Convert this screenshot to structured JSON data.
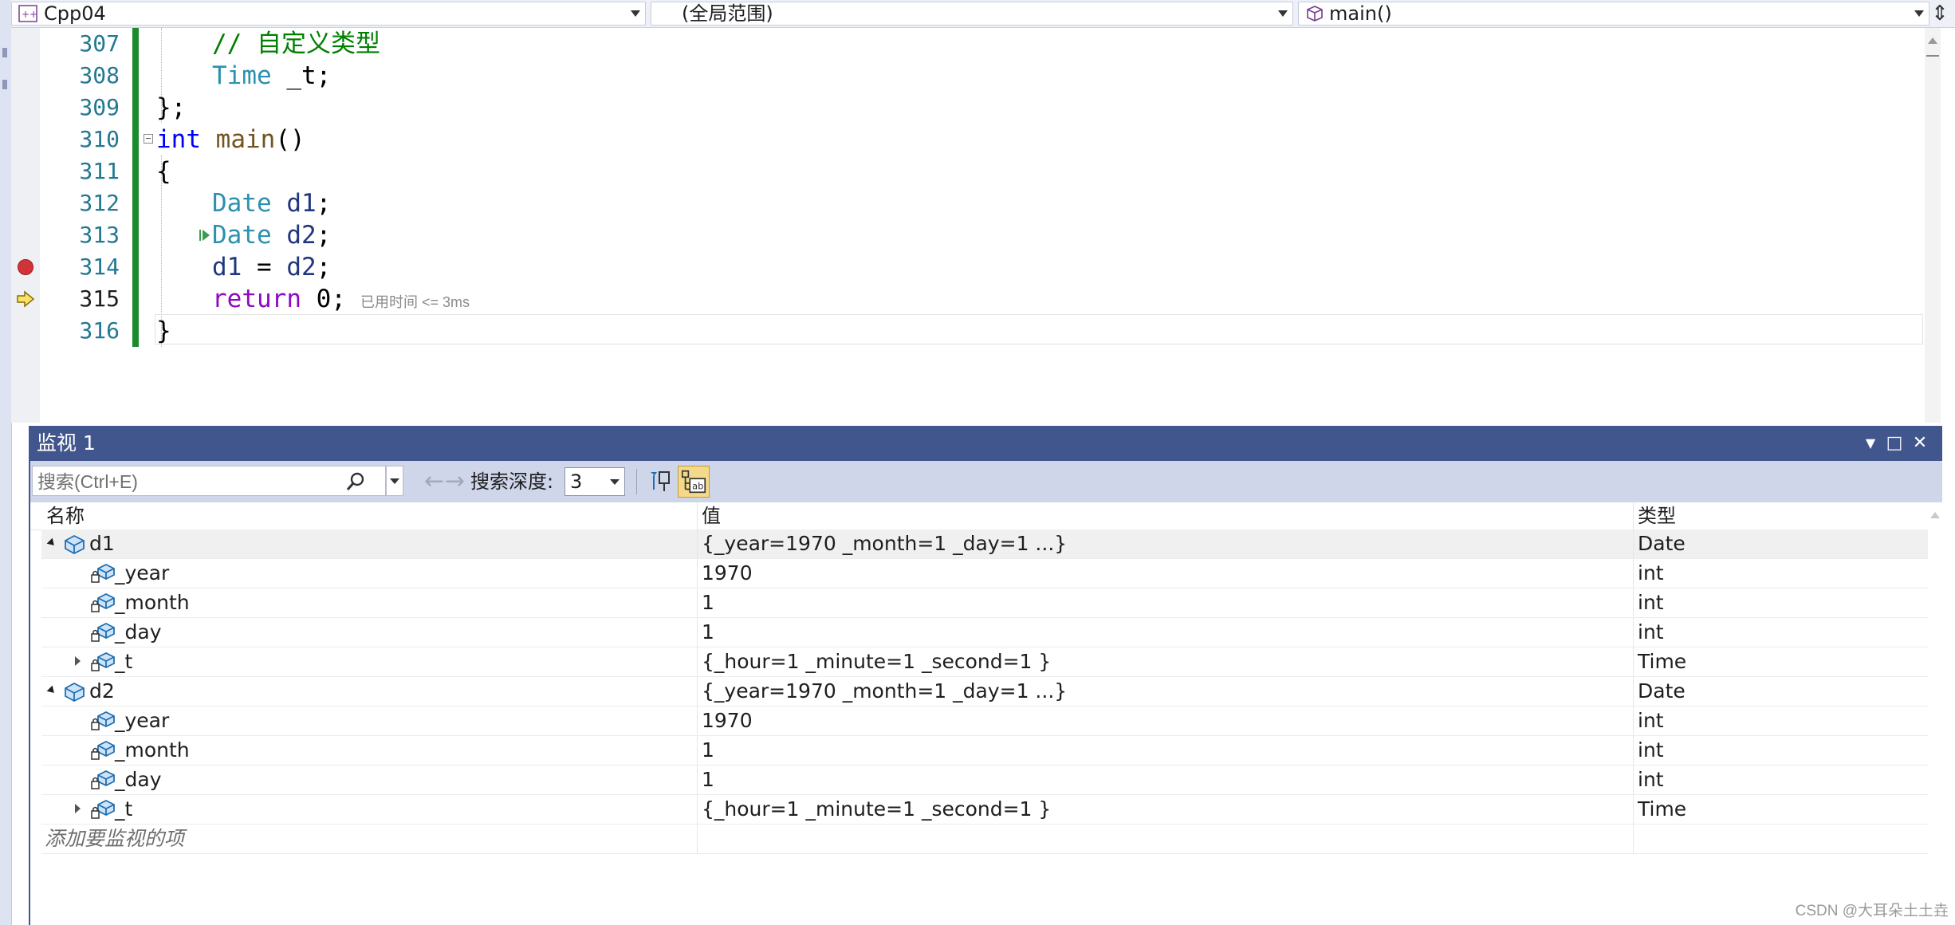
{
  "navbar": {
    "project": "Cpp04",
    "scope": "(全局范围)",
    "member": "main()",
    "project_icon": "cpp-project-icon",
    "member_icon": "method-cube-icon",
    "split_icon": "split-window-icon"
  },
  "editor": {
    "lines": [
      {
        "number": "307",
        "comment": "// 自定义类型"
      },
      {
        "number": "308",
        "type": "Time",
        "rest": " _t;"
      },
      {
        "number": "309",
        "text": "};"
      },
      {
        "number": "310",
        "kw": "int",
        "fn": "main",
        "rest": "()"
      },
      {
        "number": "311",
        "text": "{"
      },
      {
        "number": "312",
        "type": "Date",
        "var": "d1",
        "rest": ";"
      },
      {
        "number": "313",
        "type": "Date",
        "var": "d2",
        "rest": ";"
      },
      {
        "number": "314",
        "var1": "d1",
        "op": " = ",
        "var2": "d2",
        "rest": ";"
      },
      {
        "number": "315",
        "kw": "return",
        "rest": " 0;",
        "hint": "已用时间 <= 3ms"
      },
      {
        "number": "316",
        "text": "}"
      }
    ],
    "breakpoint_line": "314",
    "current_line": "315"
  },
  "watch": {
    "title": "监视 1",
    "search_placeholder": "搜索(Ctrl+E)",
    "depth_label": "搜索深度:",
    "depth_value": "3",
    "columns": {
      "name": "名称",
      "value": "值",
      "type": "类型"
    },
    "rows": [
      {
        "name": "d1",
        "value": "{_year=1970 _month=1 _day=1 ...}",
        "type": "Date"
      },
      {
        "name": "_year",
        "value": "1970",
        "type": "int"
      },
      {
        "name": "_month",
        "value": "1",
        "type": "int"
      },
      {
        "name": "_day",
        "value": "1",
        "type": "int"
      },
      {
        "name": "_t",
        "value": "{_hour=1 _minute=1 _second=1 }",
        "type": "Time"
      },
      {
        "name": "d2",
        "value": "{_year=1970 _month=1 _day=1 ...}",
        "type": "Date"
      },
      {
        "name": "_year",
        "value": "1970",
        "type": "int"
      },
      {
        "name": "_month",
        "value": "1",
        "type": "int"
      },
      {
        "name": "_day",
        "value": "1",
        "type": "int"
      },
      {
        "name": "_t",
        "value": "{_hour=1 _minute=1 _second=1 }",
        "type": "Time"
      }
    ],
    "add_item_text": "添加要监视的项"
  },
  "watermark": "CSDN @大耳朵土土垚",
  "colors": {
    "title_bar": "#40568d",
    "toolbar": "#cfd6ea",
    "change_bar": "#1a8c2e",
    "breakpoint": "#d13438"
  }
}
